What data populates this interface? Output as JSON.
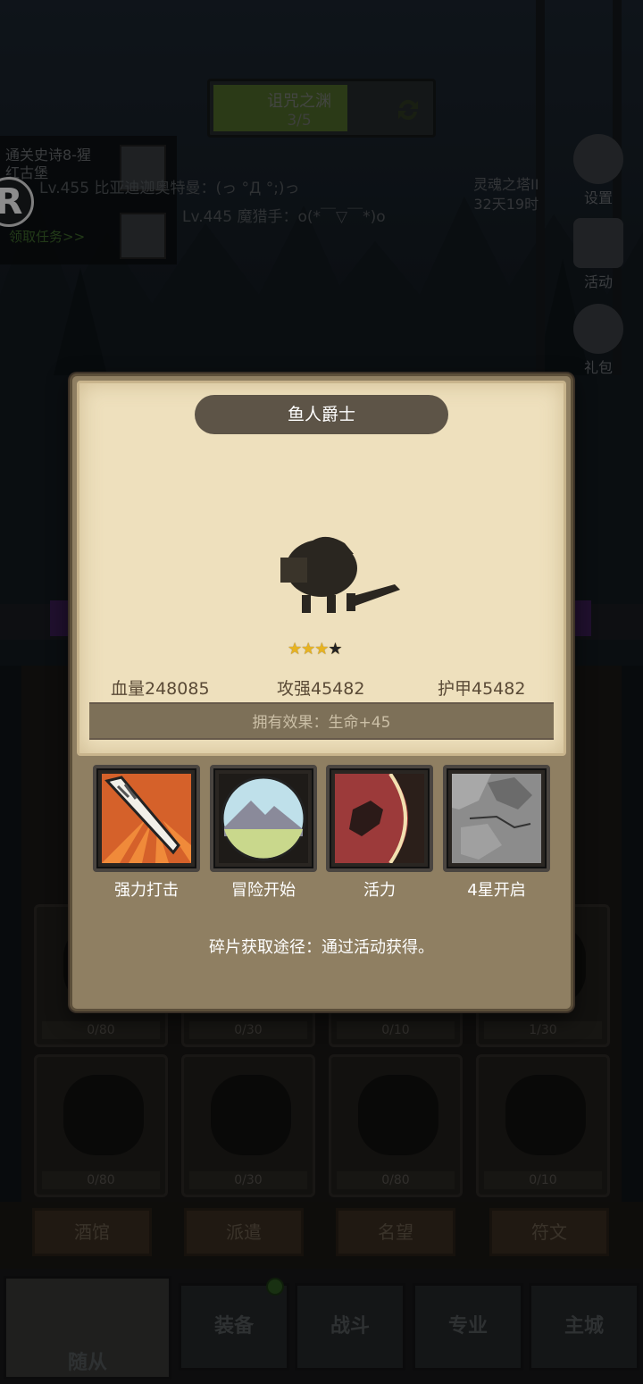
{
  "stage": {
    "title": "诅咒之渊",
    "progress_text": "3/5",
    "progress_fraction": 0.6
  },
  "quest": {
    "title_line1": "通关史诗8-猩",
    "title_line2": "红古堡",
    "claim_link": "领取任务>>"
  },
  "badge": {
    "letter": "R"
  },
  "chat": [
    "Lv.455 比亚迪迦奥特曼：(っ °Д °;)っ",
    "Lv.445 魔猎手：o(*￣▽￣*)o"
  ],
  "tower": {
    "name": "灵魂之塔II",
    "timer": "32天19时"
  },
  "side_buttons": [
    {
      "label": "设置",
      "icon": "gear-icon"
    },
    {
      "label": "活动",
      "icon": "scroll-icon"
    },
    {
      "label": "礼包",
      "icon": "gift-bag-icon"
    }
  ],
  "grid_counts": [
    "0/80",
    "0/30",
    "0/10",
    "1/30",
    "0/80",
    "0/30",
    "0/80",
    "0/10"
  ],
  "sub_tabs": [
    "酒馆",
    "派遣",
    "名望",
    "符文"
  ],
  "main_nav": [
    "随从",
    "装备",
    "战斗",
    "专业",
    "主城"
  ],
  "hero": {
    "name": "鱼人爵士",
    "stars_filled": 3,
    "stars_total": 4,
    "stats": {
      "hp": "血量248085",
      "attack": "攻强45482",
      "armor": "护甲45482"
    },
    "owned_effect": "拥有效果：生命+45",
    "skills": [
      {
        "label": "强力打击",
        "icon": "sword-strike-icon"
      },
      {
        "label": "冒险开始",
        "icon": "mountain-icon"
      },
      {
        "label": "活力",
        "icon": "vitality-icon"
      },
      {
        "label": "4星开启",
        "icon": "locked-rock-icon"
      }
    ],
    "fragment_source": "碎片获取途径：通过活动获得。"
  },
  "colors": {
    "modal_bg": "#8f7f62",
    "card_bg": "#eee0bd",
    "star": "#e7b321",
    "progress_fill": "#4f6a2a"
  }
}
